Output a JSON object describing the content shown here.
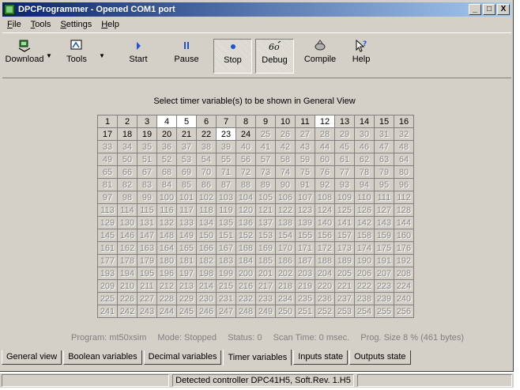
{
  "window": {
    "title": "DPCProgrammer - Opened COM1 port",
    "minimize": "_",
    "maximize": "□",
    "close": "X"
  },
  "menu": [
    {
      "label": "File",
      "u": "F",
      "rest": "ile"
    },
    {
      "label": "Tools",
      "u": "T",
      "rest": "ools"
    },
    {
      "label": "Settings",
      "u": "S",
      "rest": "ettings"
    },
    {
      "label": "Help",
      "u": "H",
      "rest": "elp"
    }
  ],
  "toolbar": {
    "download": "Download",
    "tools": "Tools",
    "start": "Start",
    "pause": "Pause",
    "stop": "Stop",
    "debug": "Debug",
    "compile": "Compile",
    "help": "Help"
  },
  "heading": "Select timer variable(s) to be shown in General View",
  "grid": {
    "start": 1,
    "end": 256,
    "columns": 16,
    "enabled_max": 24,
    "selected": [
      4,
      5,
      12,
      23
    ]
  },
  "status_line": {
    "program": "Program: mt50xsim",
    "mode": "Mode: Stopped",
    "status": "Status: 0",
    "scan": "Scan Time: 0 msec.",
    "size": "Prog. Size 8 %  (461 bytes)"
  },
  "tabs": [
    {
      "label": "General view",
      "active": false
    },
    {
      "label": "Boolean variables",
      "active": false
    },
    {
      "label": "Decimal variables",
      "active": false
    },
    {
      "label": "Timer variables",
      "active": true
    },
    {
      "label": "Inputs state",
      "active": false
    },
    {
      "label": "Outputs state",
      "active": false
    }
  ],
  "statusbar": {
    "left": "",
    "message": "Detected controller DPC41H5, Soft.Rev. 1.H5",
    "right": ""
  }
}
